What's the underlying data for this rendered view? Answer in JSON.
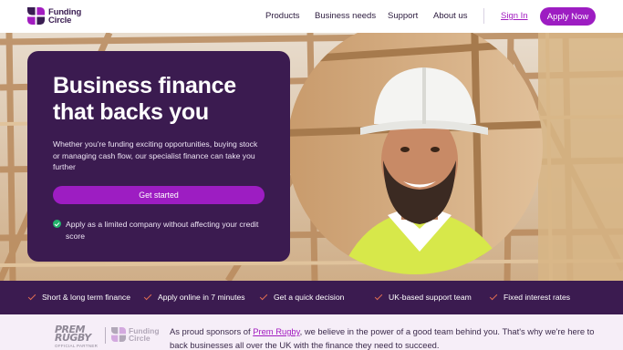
{
  "header": {
    "logo_text_line1": "Funding",
    "logo_text_line2": "Circle",
    "nav": [
      "Products",
      "Business needs",
      "Support",
      "About us"
    ],
    "sign_in": "Sign In",
    "apply_now": "Apply Now"
  },
  "hero": {
    "title_line1": "Business finance",
    "title_line2": "that backs you",
    "subtitle": "Whether you're funding exciting opportunities, buying stock or managing cash flow, our specialist finance can take you further",
    "cta": "Get started",
    "check_text": "Apply as a limited company without affecting your credit score"
  },
  "features": [
    "Short & long term finance",
    "Apply online in 7 minutes",
    "Get a quick decision",
    "UK-based support team",
    "Fixed interest rates"
  ],
  "sponsor": {
    "prem_logo_line1": "PREM",
    "prem_logo_line2": "RUGBY",
    "prem_partner": "OFFICIAL PARTNER",
    "fc_line1": "Funding",
    "fc_line2": "Circle",
    "text_before": "As proud sponsors of ",
    "link": "Prem Rugby",
    "text_after": ", we believe in the power of a good team behind you. That's why we're here to back businesses all over the UK with the finance they need to succeed."
  },
  "colors": {
    "brand_purple": "#3b1b50",
    "accent_magenta": "#9d1dc2",
    "check_green": "#23b36b",
    "tick_orange": "#e06d52"
  }
}
